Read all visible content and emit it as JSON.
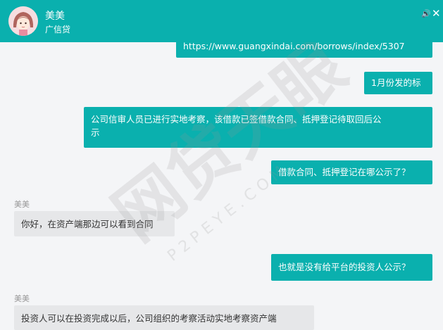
{
  "header": {
    "name": "美美",
    "subtitle": "广信贷",
    "sound_icon": "speaker-icon",
    "close_icon": "close-icon",
    "accent": "#0ab0ae"
  },
  "messages": [
    {
      "side": "out",
      "text": "https://www.guangxindai.com/borrows/index/5307"
    },
    {
      "side": "out",
      "text": "1月份发的标"
    },
    {
      "side": "out",
      "lines": [
        "公司信审人员已进行实地考察，该借款已签借款合同、抵押登记待取回后公",
        "示"
      ]
    },
    {
      "side": "out",
      "text": "借款合同、抵押登记在哪公示了？"
    },
    {
      "side": "in",
      "sender": "美美",
      "text": "你好，在资产端那边可以看到合同"
    },
    {
      "side": "out",
      "text": "也就是没有给平台的投资人公示？"
    },
    {
      "side": "in",
      "sender": "美美",
      "text": "投资人可以在投资完成以后，公司组织的考察活动实地考察资产端"
    }
  ],
  "watermark": {
    "main": "网贷天眼",
    "sub": "P 2 P E Y E . C O M"
  }
}
